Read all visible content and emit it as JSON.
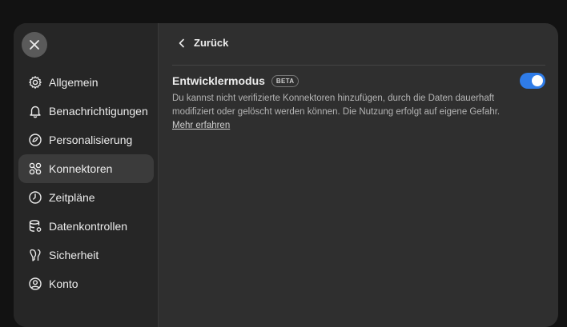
{
  "sidebar": {
    "items": [
      {
        "label": "Allgemein",
        "icon": "gear-icon"
      },
      {
        "label": "Benachrichtigungen",
        "icon": "bell-icon"
      },
      {
        "label": "Personalisierung",
        "icon": "personalization-icon"
      },
      {
        "label": "Konnektoren",
        "icon": "connectors-icon",
        "active": true
      },
      {
        "label": "Zeitpläne",
        "icon": "clock-icon"
      },
      {
        "label": "Datenkontrollen",
        "icon": "database-gear-icon"
      },
      {
        "label": "Sicherheit",
        "icon": "shield-key-icon"
      },
      {
        "label": "Konto",
        "icon": "user-circle-icon"
      }
    ]
  },
  "content": {
    "back_label": "Zurück",
    "setting_title": "Entwicklermodus",
    "badge": "BETA",
    "description": "Du kannst nicht verifizierte Konnektoren hinzufügen, durch die Daten dauerhaft modifiziert oder gelöscht werden können. Die Nutzung erfolgt auf eigene Gefahr.",
    "learn_more": "Mehr erfahren",
    "toggle_on": true
  },
  "colors": {
    "accent": "#2f7ce8",
    "modal_bg": "#2f2f2f",
    "sidebar_bg": "#262626",
    "active_item_bg": "#3b3b3b"
  }
}
